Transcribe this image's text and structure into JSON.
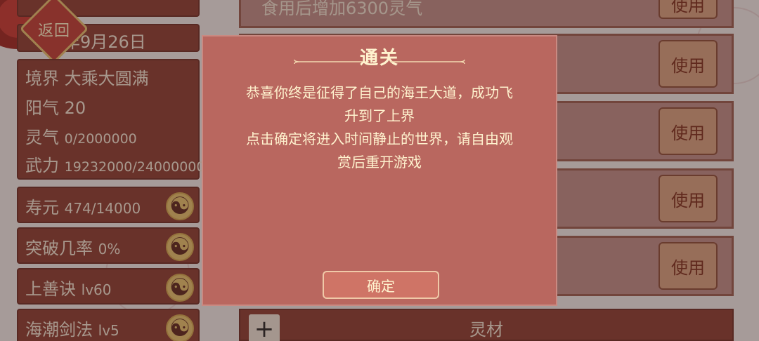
{
  "back_button": {
    "label": "返回"
  },
  "status_panel": {
    "year_text": "年9月26日",
    "realm_label": "境界",
    "realm_value": "大乘大圆满",
    "yang_label": "阳气",
    "yang_value": "20",
    "qi_label": "灵气",
    "qi_value": "0/2000000",
    "force_label": "武力",
    "force_value": "19232000/24000000"
  },
  "stats": [
    {
      "label": "寿元",
      "value": "474/14000"
    },
    {
      "label": "突破几率",
      "value": "0%"
    },
    {
      "label": "上善诀",
      "value": "lv60"
    },
    {
      "label": "海潮剑法",
      "value": "lv5"
    }
  ],
  "inventory": {
    "top_description": "食用后增加6300灵气",
    "use_label": "使用",
    "bottom_label": "灵材",
    "add_symbol": "+"
  },
  "modal": {
    "title": "通关",
    "body_line1": "恭喜你终是征得了自己的海王大道，成功飞",
    "body_line2": "升到了上界",
    "body_line3": "点击确定将进入时间静止的世界，请自由观",
    "body_line4": "赏后重开游戏",
    "confirm_label": "确定"
  },
  "colors": {
    "modal_bg": "#b9675f",
    "modal_text": "#fff3cf",
    "panel_bg": "#8b3a2c",
    "accent_gold": "#e8c36a"
  },
  "icons": {
    "taiji": "taiji-icon",
    "plus": "plus-icon"
  }
}
